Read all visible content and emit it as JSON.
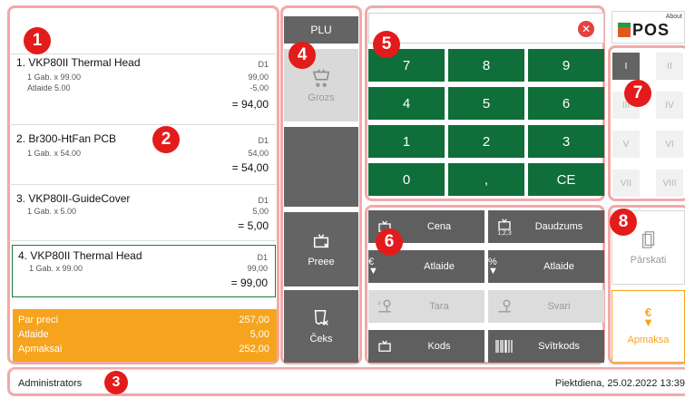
{
  "receipt": {
    "items": [
      {
        "title": "1. VKP80II Thermal Head",
        "qty_line": "1 Gab. x 99.00",
        "discount_label": "Atlaide 5.00",
        "dept": "D1",
        "price": "99,00",
        "discount": "-5,00",
        "total": "= 94,00"
      },
      {
        "title": "2. Br300-HtFan PCB",
        "qty_line": "1 Gab. x 54.00",
        "dept": "D1",
        "price": "54,00",
        "total": "= 54,00"
      },
      {
        "title": "3. VKP80II-GuideCover",
        "qty_line": "1 Gab. x 5.00",
        "dept": "D1",
        "price": "5,00",
        "total": "= 5,00"
      },
      {
        "title": "4. VKP80II Thermal Head",
        "qty_line": "1 Gab. x 99.00",
        "dept": "D1",
        "price": "99,00",
        "total": "= 99,00"
      }
    ],
    "summary": [
      {
        "label": "Par preci",
        "value": "257,00"
      },
      {
        "label": "Atlaide",
        "value": "5,00"
      },
      {
        "label": "Apmaksai",
        "value": "252,00"
      }
    ]
  },
  "middle": {
    "plu_label": "PLU",
    "basket_label": "Grozs",
    "remove_item_label": "Preee",
    "cancel_receipt_label": "Čeks"
  },
  "numpad": {
    "input_value": "",
    "keys": [
      "7",
      "8",
      "9",
      "4",
      "5",
      "6",
      "1",
      "2",
      "3",
      "0",
      ",",
      "CE"
    ]
  },
  "functions": {
    "price": "Cena",
    "quantity": "Daudzums",
    "discount_amount": "Atlaide",
    "discount_percent": "Atlaide",
    "tare": "Tara",
    "scales": "Svari",
    "code": "Kods",
    "barcode": "Svītrkods",
    "quantity_icon_sub": "1,2,3"
  },
  "brand": {
    "about": "About",
    "logo": "POS"
  },
  "departments": [
    "I",
    "II",
    "III",
    "IV",
    "V",
    "VI",
    "VII",
    "VIII"
  ],
  "right_actions": {
    "reports_label": "Pārskati",
    "payment_label": "Apmaksa"
  },
  "status": {
    "user": "Administrators",
    "datetime": "Piektdiena, 25.02.2022 13:39"
  },
  "markers": [
    "1",
    "2",
    "3",
    "4",
    "5",
    "6",
    "7",
    "8"
  ],
  "colors": {
    "numpad_green": "#0f6e3a",
    "summary_orange": "#f6a41e",
    "marker_red": "#e41b1b",
    "dark_button": "#646464"
  }
}
